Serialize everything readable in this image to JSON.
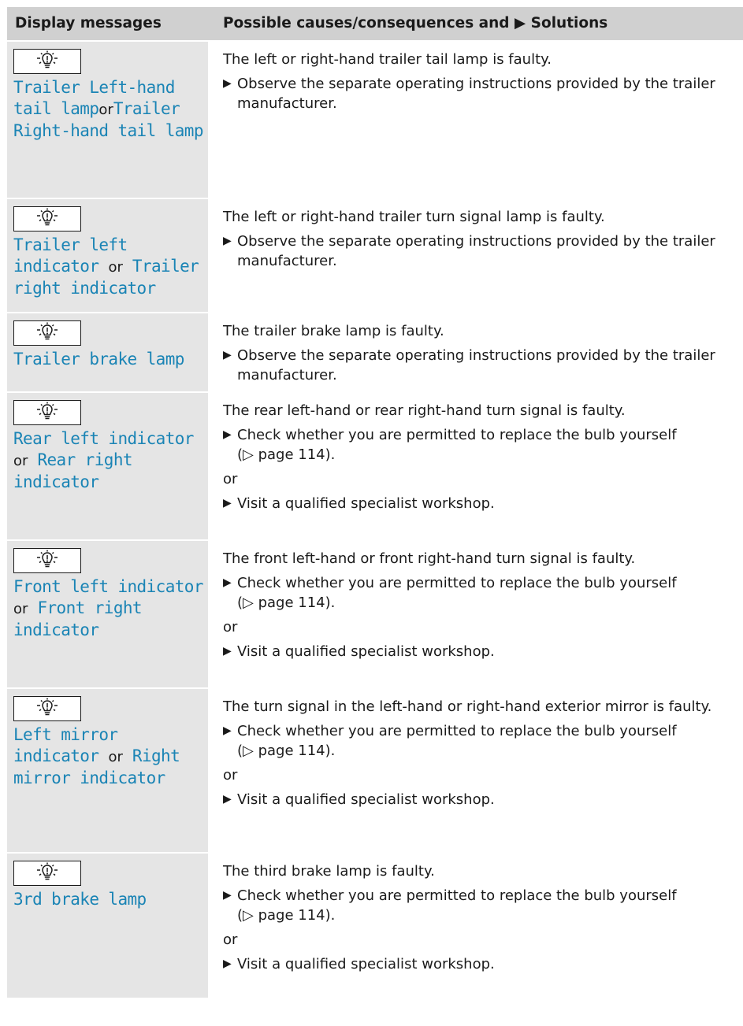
{
  "header": {
    "col1": "Display messages",
    "col2": "Possible causes/consequences and ▶ Solutions"
  },
  "icon": "bulb-warning-icon",
  "link_color": "#1a84b5",
  "rows": [
    {
      "msg_a": "Trailer Left-hand tail lamp",
      "sep": "or",
      "msg_b": "Trailer Right-hand tail lamp",
      "cause": "The left or right-hand trailer tail lamp is faulty.",
      "step1": "Observe the separate operating instructions provided by the trailer manufacturer."
    },
    {
      "msg_a": "Trailer left indicator",
      "sep": "or",
      "msg_b": "Trailer right indicator",
      "cause": "The left or right-hand trailer turn signal lamp is faulty.",
      "step1": "Observe the separate operating instructions provided by the trailer manufacturer."
    },
    {
      "msg_a": "Trailer brake lamp",
      "cause": "The trailer brake lamp is faulty.",
      "step1": "Observe the separate operating instructions provided by the trailer manufacturer."
    },
    {
      "msg_a": "Rear left indicator",
      "sep": "or",
      "msg_b": "Rear right indicator",
      "cause": "The rear left-hand or rear right-hand turn signal is faulty.",
      "step1": "Check whether you are permitted to replace the bulb yourself",
      "ref": "(▷ page 114).",
      "or": "or",
      "step2": "Visit a qualified specialist workshop."
    },
    {
      "msg_a": "Front left indicator",
      "sep": "or",
      "msg_b": "Front right indicator",
      "cause": "The front left-hand or front right-hand turn signal is faulty.",
      "step1": "Check whether you are permitted to replace the bulb yourself",
      "ref": "(▷ page 114).",
      "or": "or",
      "step2": "Visit a qualified specialist workshop."
    },
    {
      "msg_a": "Left mirror indicator",
      "sep": "or",
      "msg_b": "Right mirror indicator",
      "cause": "The turn signal in the left-hand or right-hand exterior mirror is faulty.",
      "step1": "Check whether you are permitted to replace the bulb yourself",
      "ref": "(▷ page 114).",
      "or": "or",
      "step2": "Visit a qualified specialist workshop."
    },
    {
      "msg_a": "3rd brake lamp",
      "cause": "The third brake lamp is faulty.",
      "step1": "Check whether you are permitted to replace the bulb yourself",
      "ref": "(▷ page 114).",
      "or": "or",
      "step2": "Visit a qualified specialist workshop."
    }
  ]
}
